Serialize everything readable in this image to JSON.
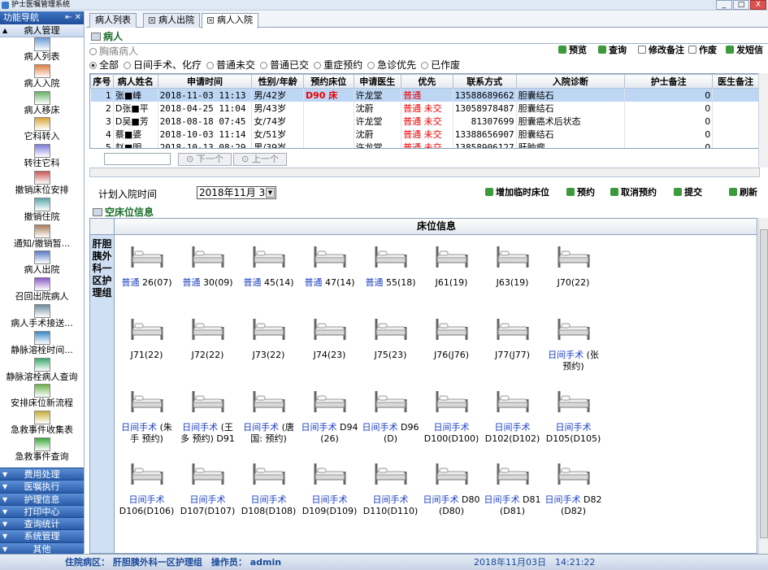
{
  "app": {
    "title": "护士医嘱管理系统",
    "win_min": "_",
    "win_max": "□",
    "win_close": "X"
  },
  "sidebar": {
    "header": "功能导航",
    "pin": "⇤ ✕",
    "active_group": "病人管理",
    "items": [
      {
        "label": "病人列表",
        "icon": "patient-list-icon"
      },
      {
        "label": "病人入院",
        "icon": "admission-icon"
      },
      {
        "label": "病人移床",
        "icon": "move-bed-icon"
      },
      {
        "label": "它科转入",
        "icon": "transfer-in-icon"
      },
      {
        "label": "转往它科",
        "icon": "transfer-out-icon"
      },
      {
        "label": "撤销床位安排",
        "icon": "cancel-bed-icon"
      },
      {
        "label": "撤销住院",
        "icon": "cancel-admission-icon"
      },
      {
        "label": "通知/撤销暂...",
        "icon": "notice-icon"
      },
      {
        "label": "病人出院",
        "icon": "discharge-icon"
      },
      {
        "label": "召回出院病人",
        "icon": "recall-icon"
      },
      {
        "label": "病人手术接送...",
        "icon": "surgery-transfer-icon"
      },
      {
        "label": "静脉溶栓时间...",
        "icon": "thrombolysis-time-icon"
      },
      {
        "label": "静脉溶栓病人查询",
        "icon": "thrombolysis-query-icon"
      },
      {
        "label": "安排床位新流程",
        "icon": "arrange-bed-icon"
      },
      {
        "label": "急救事件收集表",
        "icon": "emergency-form-icon"
      },
      {
        "label": "急救事件查询",
        "icon": "emergency-query-icon"
      }
    ],
    "groups": [
      "费用处理",
      "医嘱执行",
      "护理信息",
      "打印中心",
      "查询统计",
      "系统管理",
      "其他"
    ]
  },
  "tabs": [
    {
      "label": "病人列表",
      "closable": false
    },
    {
      "label": "病人出院",
      "closable": true
    },
    {
      "label": "病人入院",
      "closable": true,
      "active": true
    }
  ],
  "patient_section": {
    "title": "病人",
    "chest_pain": "胸痛病人",
    "toolbar": [
      "预览",
      "查询",
      "修改备注",
      "作废",
      "发短信"
    ],
    "filters": [
      {
        "label": "全部",
        "checked": true
      },
      {
        "label": "日间手术、化疗",
        "checked": false
      },
      {
        "label": "普通未交",
        "checked": false
      },
      {
        "label": "普通已交",
        "checked": false
      },
      {
        "label": "重症预约",
        "checked": false
      },
      {
        "label": "急诊优先",
        "checked": false
      },
      {
        "label": "已作废",
        "checked": false
      }
    ],
    "columns": [
      "序号",
      "病人姓名",
      "申请时间",
      "性别/年龄",
      "预约床位",
      "申请医生",
      "优先",
      "联系方式",
      "入院诊断",
      "护士备注",
      "医生备注"
    ],
    "rows": [
      {
        "no": "1",
        "name": "张■峰",
        "time": "2018-11-03 11:13",
        "sex_age": "男/42岁",
        "bed": "D90 床",
        "doctor": "许龙堂",
        "priority": "普通",
        "unsub": "",
        "phone": "13588689662",
        "diag": "胆囊结石",
        "nurse_note": "0",
        "selected": true
      },
      {
        "no": "2",
        "name": "D张■平",
        "time": "2018-04-25 11:04",
        "sex_age": "男/43岁",
        "bed": "",
        "doctor": "沈蔚",
        "priority": "普通",
        "unsub": "未交",
        "phone": "13058978487",
        "diag": "胆囊结石",
        "nurse_note": "0"
      },
      {
        "no": "3",
        "name": "D吴■芳",
        "time": "2018-08-18 07:45",
        "sex_age": "女/74岁",
        "bed": "",
        "doctor": "许龙堂",
        "priority": "普通",
        "unsub": "未交",
        "phone": "81307699",
        "diag": "胆囊癌术后状态",
        "nurse_note": "0"
      },
      {
        "no": "4",
        "name": "蔡■婆",
        "time": "2018-10-03 11:14",
        "sex_age": "女/51岁",
        "bed": "",
        "doctor": "沈蔚",
        "priority": "普通",
        "unsub": "未交",
        "phone": "13388656907",
        "diag": "胆囊结石",
        "nurse_note": "0"
      },
      {
        "no": "5",
        "name": "赵■明",
        "time": "2018-10-13 08:29",
        "sex_age": "男/39岁",
        "bed": "",
        "doctor": "许龙堂",
        "priority": "普通",
        "unsub": "未交",
        "phone": "13858906127",
        "diag": "肝肿瘤",
        "nurse_note": "0"
      }
    ],
    "next": "下一个",
    "prev": "上一个"
  },
  "plan": {
    "label": "计划入院时间",
    "date": "2018年11月 3日",
    "actions": [
      "增加临时床位",
      "预约",
      "取消预约",
      "提交",
      "刷新"
    ]
  },
  "beds_section": {
    "title": "空床位信息",
    "header": "床位信息",
    "ward": "肝胆胰外科一区护理组",
    "beds": [
      {
        "tag": "普通",
        "code": "26(07)"
      },
      {
        "tag": "普通",
        "code": "30(09)"
      },
      {
        "tag": "普通",
        "code": "45(14)"
      },
      {
        "tag": "普通",
        "code": "47(14)"
      },
      {
        "tag": "普通",
        "code": "55(18)"
      },
      {
        "tag": "",
        "code": "J61(19)"
      },
      {
        "tag": "",
        "code": "J63(19)"
      },
      {
        "tag": "",
        "code": "J70(22)"
      },
      {
        "tag": "",
        "code": "J71(22)"
      },
      {
        "tag": "",
        "code": "J72(22)"
      },
      {
        "tag": "",
        "code": "J73(22)"
      },
      {
        "tag": "",
        "code": "J74(23)"
      },
      {
        "tag": "",
        "code": "J75(23)"
      },
      {
        "tag": "",
        "code": "J76(J76)"
      },
      {
        "tag": "",
        "code": "J77(J77)"
      },
      {
        "tag": "日间手术",
        "code": "(张",
        "line2": "预约)"
      },
      {
        "tag": "日间手术",
        "code": "(朱",
        "line2": "手  预约)"
      },
      {
        "tag": "日间手术",
        "code": "(王",
        "line2": "多  预约) D91"
      },
      {
        "tag": "日间手术",
        "code": "(唐",
        "line2": "国: 预约)"
      },
      {
        "tag": "日间手术",
        "code": "D94",
        "line2": "(26)"
      },
      {
        "tag": "日间手术",
        "code": "D96",
        "line2": "(D)"
      },
      {
        "tag": "日间手术",
        "code": "",
        "line2": "D100(D100)"
      },
      {
        "tag": "日间手术",
        "code": "",
        "line2": "D102(D102)"
      },
      {
        "tag": "日间手术",
        "code": "",
        "line2": "D105(D105)"
      },
      {
        "tag": "日间手术",
        "code": "",
        "line2": "D106(D106)"
      },
      {
        "tag": "日间手术",
        "code": "",
        "line2": "D107(D107)"
      },
      {
        "tag": "日间手术",
        "code": "",
        "line2": "D108(D108)"
      },
      {
        "tag": "日间手术",
        "code": "",
        "line2": "D109(D109)"
      },
      {
        "tag": "日间手术",
        "code": "",
        "line2": "D110(D110)"
      },
      {
        "tag": "日间手术",
        "code": "D80",
        "line2": "(D80)"
      },
      {
        "tag": "日间手术",
        "code": "D81",
        "line2": "(D81)"
      },
      {
        "tag": "日间手术",
        "code": "D82",
        "line2": "(D82)"
      }
    ]
  },
  "status": {
    "ward_label": "住院病区：",
    "ward": "肝胆胰外科一区护理组",
    "operator_label": "操作员：",
    "operator": "admin",
    "date": "2018年11月03日",
    "time": "14:21:22"
  }
}
